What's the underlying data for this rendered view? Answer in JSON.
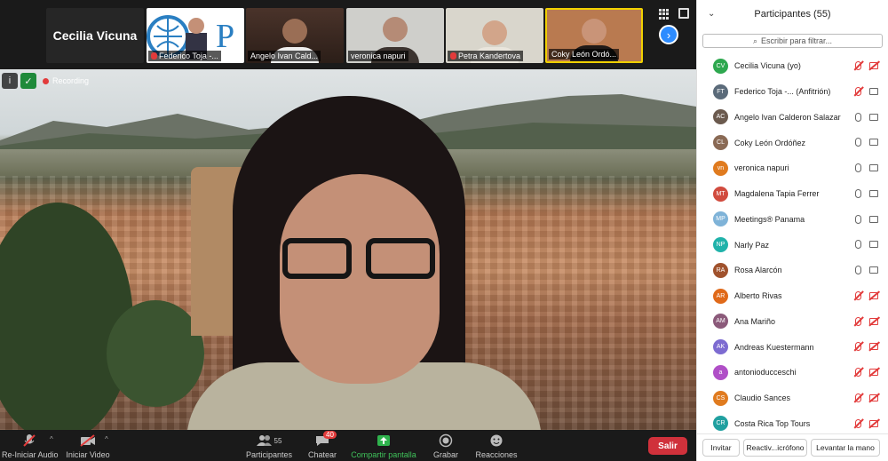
{
  "thumbnails": [
    {
      "name": "Cecilia Vicuna",
      "muted": false,
      "type": "name-only"
    },
    {
      "name": "Federico Toja -...",
      "muted": true,
      "type": "logo"
    },
    {
      "name": "Angelo Ivan Cald...",
      "muted": false,
      "type": "video"
    },
    {
      "name": "veronica napuri",
      "muted": false,
      "type": "video"
    },
    {
      "name": "Petra Kandertova",
      "muted": true,
      "type": "video"
    },
    {
      "name": "Coky León Ordó...",
      "muted": false,
      "type": "video"
    }
  ],
  "recording_label": "Recording",
  "toolbar": {
    "audio": "Re-Iniciar Audio",
    "video": "Iniciar Video",
    "participants": "Participantes",
    "participants_count": "55",
    "chat": "Chatear",
    "chat_badge": "40",
    "share": "Compartir pantalla",
    "record": "Grabar",
    "reactions": "Reacciones",
    "leave": "Salir"
  },
  "panel": {
    "title": "Participantes (55)",
    "filter_placeholder": "Escribir para filtrar...",
    "participants": [
      {
        "name": "Cecilia Vicuna (yo)",
        "initials": "CV",
        "color": "#2ea84f",
        "mic_muted": true,
        "cam_off": true
      },
      {
        "name": "Federico Toja -...  (Anfitrión)",
        "initials": "FT",
        "color": "#5b6b7a",
        "mic_muted": true,
        "cam_off": false
      },
      {
        "name": "Angelo Ivan Calderon Salazar",
        "initials": "AC",
        "color": "#6b5a4e",
        "mic_muted": false,
        "cam_off": false
      },
      {
        "name": "Coky León Ordóñez",
        "initials": "CL",
        "color": "#8a6a55",
        "mic_muted": false,
        "cam_off": false
      },
      {
        "name": "veronica napuri",
        "initials": "vn",
        "color": "#e07b1f",
        "mic_muted": false,
        "cam_off": false
      },
      {
        "name": "Magdalena Tapia Ferrer",
        "initials": "MT",
        "color": "#d14b3e",
        "mic_muted": false,
        "cam_off": false
      },
      {
        "name": "Meetings® Panama",
        "initials": "MP",
        "color": "#7fb3d8",
        "mic_muted": false,
        "cam_off": false
      },
      {
        "name": "Narly Paz",
        "initials": "NP",
        "color": "#20b2aa",
        "mic_muted": false,
        "cam_off": false
      },
      {
        "name": "Rosa Alarcón",
        "initials": "RA",
        "color": "#a0522d",
        "mic_muted": false,
        "cam_off": false
      },
      {
        "name": "Alberto Rivas",
        "initials": "AR",
        "color": "#e06a1a",
        "mic_muted": true,
        "cam_off": true
      },
      {
        "name": "Ana Mariño",
        "initials": "AM",
        "color": "#8b5a7a",
        "mic_muted": true,
        "cam_off": true
      },
      {
        "name": "Andreas Kuestermann",
        "initials": "AK",
        "color": "#7d6bd1",
        "mic_muted": true,
        "cam_off": true
      },
      {
        "name": "antonioducceschi",
        "initials": "a",
        "color": "#b04fc7",
        "mic_muted": true,
        "cam_off": true
      },
      {
        "name": "Claudio Sances",
        "initials": "CS",
        "color": "#e07b1f",
        "mic_muted": true,
        "cam_off": true
      },
      {
        "name": "Costa Rica Top Tours",
        "initials": "CR",
        "color": "#20a0a0",
        "mic_muted": true,
        "cam_off": true
      }
    ],
    "footer": {
      "invite": "Invitar",
      "reactivate_mic": "Reactiv...icrófono",
      "raise_hand": "Levantar la mano"
    }
  }
}
